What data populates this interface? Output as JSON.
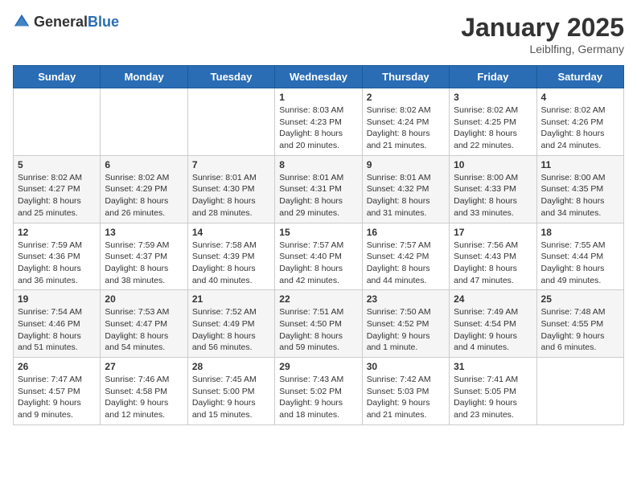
{
  "header": {
    "logo_general": "General",
    "logo_blue": "Blue",
    "title": "January 2025",
    "location": "Leiblfing, Germany"
  },
  "calendar": {
    "days_of_week": [
      "Sunday",
      "Monday",
      "Tuesday",
      "Wednesday",
      "Thursday",
      "Friday",
      "Saturday"
    ],
    "weeks": [
      [
        {
          "day": "",
          "info": ""
        },
        {
          "day": "",
          "info": ""
        },
        {
          "day": "",
          "info": ""
        },
        {
          "day": "1",
          "info": "Sunrise: 8:03 AM\nSunset: 4:23 PM\nDaylight: 8 hours\nand 20 minutes."
        },
        {
          "day": "2",
          "info": "Sunrise: 8:02 AM\nSunset: 4:24 PM\nDaylight: 8 hours\nand 21 minutes."
        },
        {
          "day": "3",
          "info": "Sunrise: 8:02 AM\nSunset: 4:25 PM\nDaylight: 8 hours\nand 22 minutes."
        },
        {
          "day": "4",
          "info": "Sunrise: 8:02 AM\nSunset: 4:26 PM\nDaylight: 8 hours\nand 24 minutes."
        }
      ],
      [
        {
          "day": "5",
          "info": "Sunrise: 8:02 AM\nSunset: 4:27 PM\nDaylight: 8 hours\nand 25 minutes."
        },
        {
          "day": "6",
          "info": "Sunrise: 8:02 AM\nSunset: 4:29 PM\nDaylight: 8 hours\nand 26 minutes."
        },
        {
          "day": "7",
          "info": "Sunrise: 8:01 AM\nSunset: 4:30 PM\nDaylight: 8 hours\nand 28 minutes."
        },
        {
          "day": "8",
          "info": "Sunrise: 8:01 AM\nSunset: 4:31 PM\nDaylight: 8 hours\nand 29 minutes."
        },
        {
          "day": "9",
          "info": "Sunrise: 8:01 AM\nSunset: 4:32 PM\nDaylight: 8 hours\nand 31 minutes."
        },
        {
          "day": "10",
          "info": "Sunrise: 8:00 AM\nSunset: 4:33 PM\nDaylight: 8 hours\nand 33 minutes."
        },
        {
          "day": "11",
          "info": "Sunrise: 8:00 AM\nSunset: 4:35 PM\nDaylight: 8 hours\nand 34 minutes."
        }
      ],
      [
        {
          "day": "12",
          "info": "Sunrise: 7:59 AM\nSunset: 4:36 PM\nDaylight: 8 hours\nand 36 minutes."
        },
        {
          "day": "13",
          "info": "Sunrise: 7:59 AM\nSunset: 4:37 PM\nDaylight: 8 hours\nand 38 minutes."
        },
        {
          "day": "14",
          "info": "Sunrise: 7:58 AM\nSunset: 4:39 PM\nDaylight: 8 hours\nand 40 minutes."
        },
        {
          "day": "15",
          "info": "Sunrise: 7:57 AM\nSunset: 4:40 PM\nDaylight: 8 hours\nand 42 minutes."
        },
        {
          "day": "16",
          "info": "Sunrise: 7:57 AM\nSunset: 4:42 PM\nDaylight: 8 hours\nand 44 minutes."
        },
        {
          "day": "17",
          "info": "Sunrise: 7:56 AM\nSunset: 4:43 PM\nDaylight: 8 hours\nand 47 minutes."
        },
        {
          "day": "18",
          "info": "Sunrise: 7:55 AM\nSunset: 4:44 PM\nDaylight: 8 hours\nand 49 minutes."
        }
      ],
      [
        {
          "day": "19",
          "info": "Sunrise: 7:54 AM\nSunset: 4:46 PM\nDaylight: 8 hours\nand 51 minutes."
        },
        {
          "day": "20",
          "info": "Sunrise: 7:53 AM\nSunset: 4:47 PM\nDaylight: 8 hours\nand 54 minutes."
        },
        {
          "day": "21",
          "info": "Sunrise: 7:52 AM\nSunset: 4:49 PM\nDaylight: 8 hours\nand 56 minutes."
        },
        {
          "day": "22",
          "info": "Sunrise: 7:51 AM\nSunset: 4:50 PM\nDaylight: 8 hours\nand 59 minutes."
        },
        {
          "day": "23",
          "info": "Sunrise: 7:50 AM\nSunset: 4:52 PM\nDaylight: 9 hours\nand 1 minute."
        },
        {
          "day": "24",
          "info": "Sunrise: 7:49 AM\nSunset: 4:54 PM\nDaylight: 9 hours\nand 4 minutes."
        },
        {
          "day": "25",
          "info": "Sunrise: 7:48 AM\nSunset: 4:55 PM\nDaylight: 9 hours\nand 6 minutes."
        }
      ],
      [
        {
          "day": "26",
          "info": "Sunrise: 7:47 AM\nSunset: 4:57 PM\nDaylight: 9 hours\nand 9 minutes."
        },
        {
          "day": "27",
          "info": "Sunrise: 7:46 AM\nSunset: 4:58 PM\nDaylight: 9 hours\nand 12 minutes."
        },
        {
          "day": "28",
          "info": "Sunrise: 7:45 AM\nSunset: 5:00 PM\nDaylight: 9 hours\nand 15 minutes."
        },
        {
          "day": "29",
          "info": "Sunrise: 7:43 AM\nSunset: 5:02 PM\nDaylight: 9 hours\nand 18 minutes."
        },
        {
          "day": "30",
          "info": "Sunrise: 7:42 AM\nSunset: 5:03 PM\nDaylight: 9 hours\nand 21 minutes."
        },
        {
          "day": "31",
          "info": "Sunrise: 7:41 AM\nSunset: 5:05 PM\nDaylight: 9 hours\nand 23 minutes."
        },
        {
          "day": "",
          "info": ""
        }
      ]
    ]
  }
}
